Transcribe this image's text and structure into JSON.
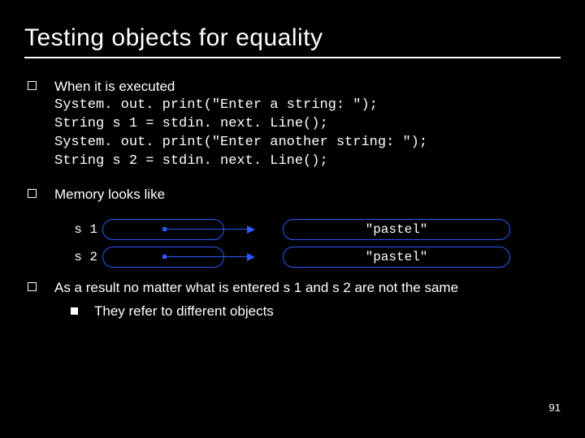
{
  "title": "Testing objects for equality",
  "bullets": {
    "b1": {
      "intro": "When it is executed",
      "code1": "System. out. print(\"Enter a string: \");",
      "code2": "String s 1 = stdin. next. Line();",
      "code3": "System. out. print(\"Enter another string: \");",
      "code4": "String s 2 = stdin. next. Line();"
    },
    "b2": "Memory looks like",
    "b3": {
      "text": "As a result no matter what is entered s 1 and s 2 are not the same",
      "sub": "They refer to different objects"
    }
  },
  "diagram": {
    "rows": [
      {
        "var": "s 1",
        "value": "\"pastel\""
      },
      {
        "var": "s 2",
        "value": "\"pastel\""
      }
    ]
  },
  "page_number": "91"
}
